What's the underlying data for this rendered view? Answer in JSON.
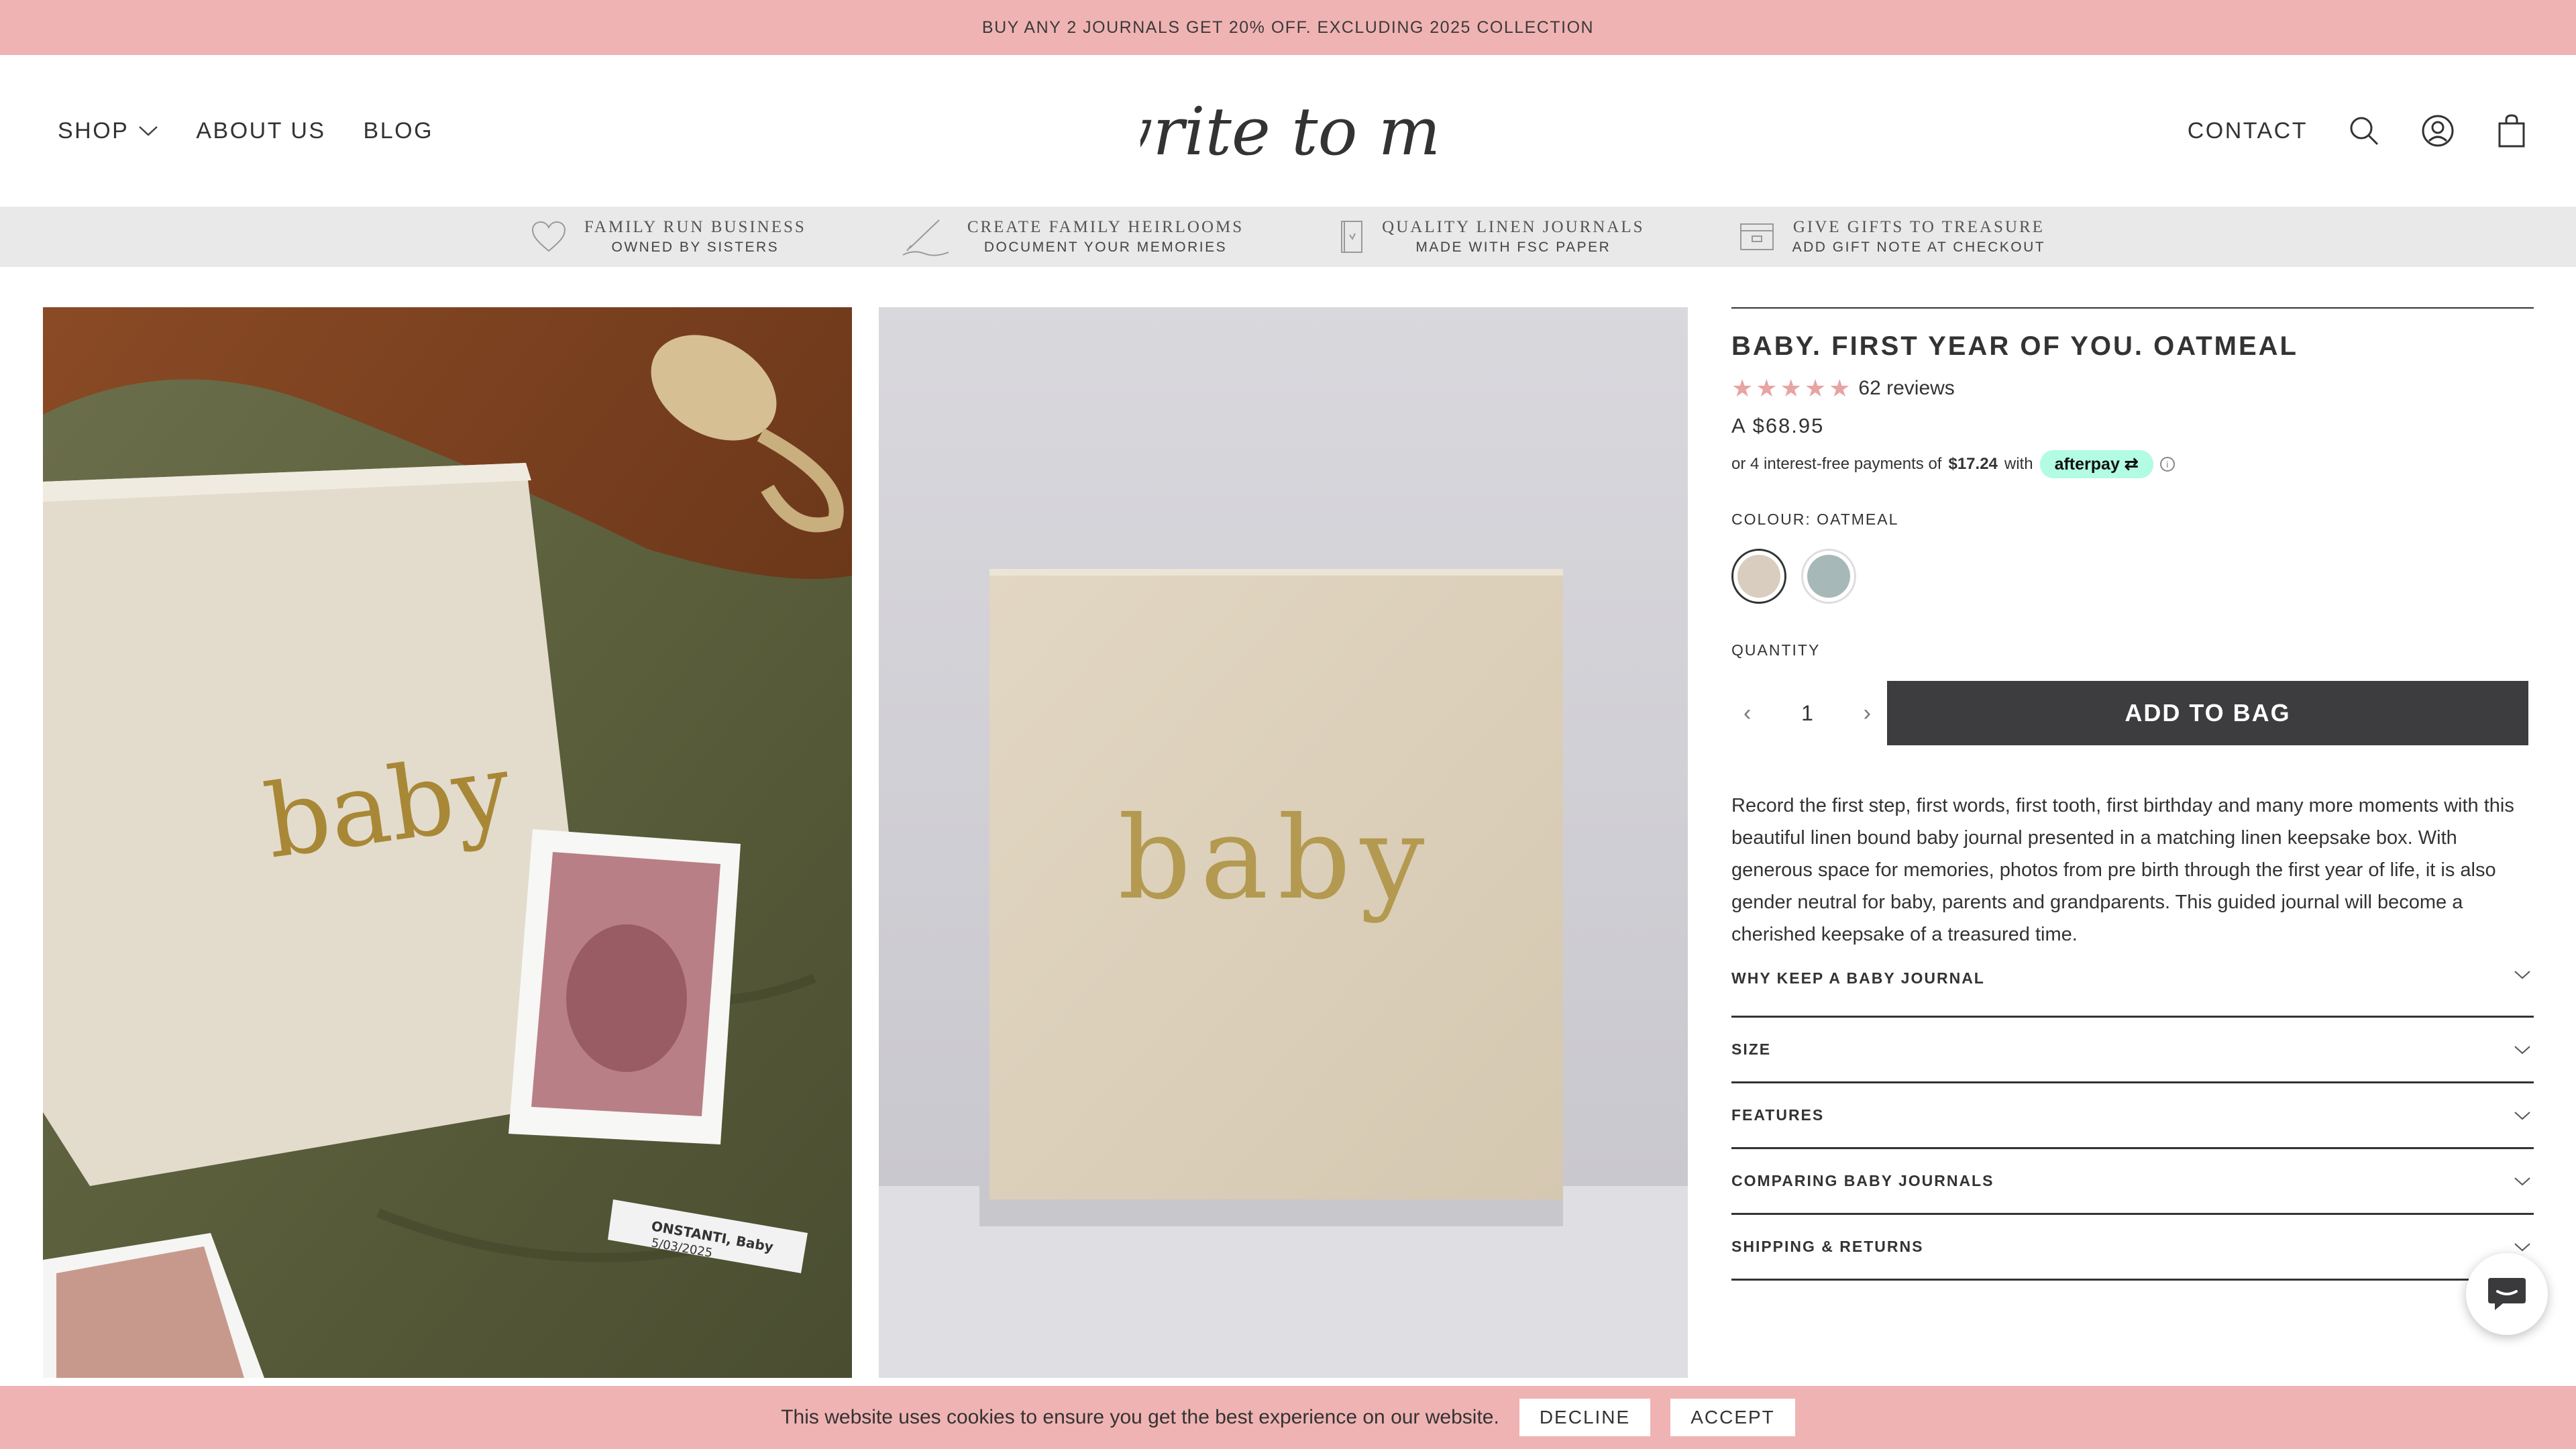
{
  "announcement": "BUY ANY 2 JOURNALS GET 20% OFF. EXCLUDING 2025 COLLECTION",
  "header": {
    "nav_left": [
      "SHOP",
      "ABOUT US",
      "BLOG"
    ],
    "logo_text": "write to me",
    "contact": "CONTACT",
    "icons": [
      "search-icon",
      "account-icon",
      "bag-icon"
    ]
  },
  "trust": [
    {
      "icon": "heart-icon",
      "title": "FAMILY RUN BUSINESS",
      "subtitle": "OWNED BY SISTERS"
    },
    {
      "icon": "pen-icon",
      "title": "CREATE FAMILY HEIRLOOMS",
      "subtitle": "DOCUMENT YOUR MEMORIES"
    },
    {
      "icon": "journal-icon",
      "title": "QUALITY LINEN JOURNALS",
      "subtitle": "MADE WITH FSC PAPER"
    },
    {
      "icon": "gift-card-icon",
      "title": "GIVE GIFTS TO TREASURE",
      "subtitle": "ADD GIFT NOTE AT CHECKOUT"
    }
  ],
  "images": {
    "cover_word": "baby",
    "tag_text1": "ONSTANTI, Baby",
    "tag_text2": "5/03/2025"
  },
  "product": {
    "title": "BABY. FIRST YEAR OF YOU. OATMEAL",
    "rating": 5,
    "reviews": "62 reviews",
    "price": "A $68.95",
    "afterpay_prefix": "or 4 interest-free payments of",
    "afterpay_amount": "$17.24",
    "afterpay_with": "with",
    "afterpay_brand": "afterpay",
    "colour_label": "COLOUR: OATMEAL",
    "swatches": [
      {
        "name": "Oatmeal",
        "color": "#d9cdbf",
        "selected": true
      },
      {
        "name": "Sage",
        "color": "#a7b8b8",
        "selected": false
      }
    ],
    "quantity_label": "QUANTITY",
    "quantity": "1",
    "add_button": "ADD TO BAG",
    "description": "Record the first step, first words, first tooth, first birthday and many more moments with this beautiful linen bound baby journal presented in a matching linen keepsake box. With generous space for memories, photos from pre birth through the first year of life, it is also gender neutral for baby, parents and grandparents. This guided journal will become a cherished keepsake of a treasured time.",
    "accordions": [
      "WHY KEEP A BABY JOURNAL",
      "SIZE",
      "FEATURES",
      "COMPARING BABY JOURNALS",
      "SHIPPING & RETURNS"
    ]
  },
  "cookie": {
    "text": "This website uses cookies to ensure you get the best experience on our website.",
    "decline": "DECLINE",
    "accept": "ACCEPT"
  },
  "colors": {
    "accent_pink": "#f0b3b3",
    "button_dark": "#3d3d3f",
    "afterpay_mint": "#b2fce4"
  }
}
